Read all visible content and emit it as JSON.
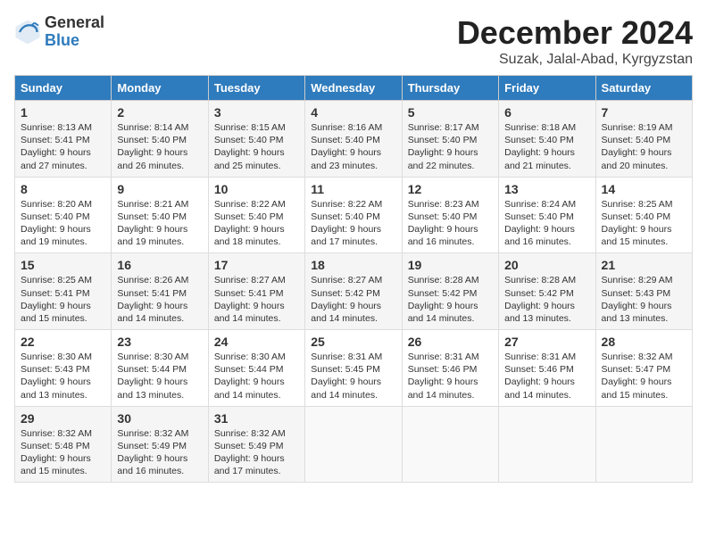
{
  "header": {
    "logo_general": "General",
    "logo_blue": "Blue",
    "month": "December 2024",
    "location": "Suzak, Jalal-Abad, Kyrgyzstan"
  },
  "days_of_week": [
    "Sunday",
    "Monday",
    "Tuesday",
    "Wednesday",
    "Thursday",
    "Friday",
    "Saturday"
  ],
  "weeks": [
    [
      {
        "day": "1",
        "info": "Sunrise: 8:13 AM\nSunset: 5:41 PM\nDaylight: 9 hours and 27 minutes."
      },
      {
        "day": "2",
        "info": "Sunrise: 8:14 AM\nSunset: 5:40 PM\nDaylight: 9 hours and 26 minutes."
      },
      {
        "day": "3",
        "info": "Sunrise: 8:15 AM\nSunset: 5:40 PM\nDaylight: 9 hours and 25 minutes."
      },
      {
        "day": "4",
        "info": "Sunrise: 8:16 AM\nSunset: 5:40 PM\nDaylight: 9 hours and 23 minutes."
      },
      {
        "day": "5",
        "info": "Sunrise: 8:17 AM\nSunset: 5:40 PM\nDaylight: 9 hours and 22 minutes."
      },
      {
        "day": "6",
        "info": "Sunrise: 8:18 AM\nSunset: 5:40 PM\nDaylight: 9 hours and 21 minutes."
      },
      {
        "day": "7",
        "info": "Sunrise: 8:19 AM\nSunset: 5:40 PM\nDaylight: 9 hours and 20 minutes."
      }
    ],
    [
      {
        "day": "8",
        "info": "Sunrise: 8:20 AM\nSunset: 5:40 PM\nDaylight: 9 hours and 19 minutes."
      },
      {
        "day": "9",
        "info": "Sunrise: 8:21 AM\nSunset: 5:40 PM\nDaylight: 9 hours and 19 minutes."
      },
      {
        "day": "10",
        "info": "Sunrise: 8:22 AM\nSunset: 5:40 PM\nDaylight: 9 hours and 18 minutes."
      },
      {
        "day": "11",
        "info": "Sunrise: 8:22 AM\nSunset: 5:40 PM\nDaylight: 9 hours and 17 minutes."
      },
      {
        "day": "12",
        "info": "Sunrise: 8:23 AM\nSunset: 5:40 PM\nDaylight: 9 hours and 16 minutes."
      },
      {
        "day": "13",
        "info": "Sunrise: 8:24 AM\nSunset: 5:40 PM\nDaylight: 9 hours and 16 minutes."
      },
      {
        "day": "14",
        "info": "Sunrise: 8:25 AM\nSunset: 5:40 PM\nDaylight: 9 hours and 15 minutes."
      }
    ],
    [
      {
        "day": "15",
        "info": "Sunrise: 8:25 AM\nSunset: 5:41 PM\nDaylight: 9 hours and 15 minutes."
      },
      {
        "day": "16",
        "info": "Sunrise: 8:26 AM\nSunset: 5:41 PM\nDaylight: 9 hours and 14 minutes."
      },
      {
        "day": "17",
        "info": "Sunrise: 8:27 AM\nSunset: 5:41 PM\nDaylight: 9 hours and 14 minutes."
      },
      {
        "day": "18",
        "info": "Sunrise: 8:27 AM\nSunset: 5:42 PM\nDaylight: 9 hours and 14 minutes."
      },
      {
        "day": "19",
        "info": "Sunrise: 8:28 AM\nSunset: 5:42 PM\nDaylight: 9 hours and 14 minutes."
      },
      {
        "day": "20",
        "info": "Sunrise: 8:28 AM\nSunset: 5:42 PM\nDaylight: 9 hours and 13 minutes."
      },
      {
        "day": "21",
        "info": "Sunrise: 8:29 AM\nSunset: 5:43 PM\nDaylight: 9 hours and 13 minutes."
      }
    ],
    [
      {
        "day": "22",
        "info": "Sunrise: 8:30 AM\nSunset: 5:43 PM\nDaylight: 9 hours and 13 minutes."
      },
      {
        "day": "23",
        "info": "Sunrise: 8:30 AM\nSunset: 5:44 PM\nDaylight: 9 hours and 13 minutes."
      },
      {
        "day": "24",
        "info": "Sunrise: 8:30 AM\nSunset: 5:44 PM\nDaylight: 9 hours and 14 minutes."
      },
      {
        "day": "25",
        "info": "Sunrise: 8:31 AM\nSunset: 5:45 PM\nDaylight: 9 hours and 14 minutes."
      },
      {
        "day": "26",
        "info": "Sunrise: 8:31 AM\nSunset: 5:46 PM\nDaylight: 9 hours and 14 minutes."
      },
      {
        "day": "27",
        "info": "Sunrise: 8:31 AM\nSunset: 5:46 PM\nDaylight: 9 hours and 14 minutes."
      },
      {
        "day": "28",
        "info": "Sunrise: 8:32 AM\nSunset: 5:47 PM\nDaylight: 9 hours and 15 minutes."
      }
    ],
    [
      {
        "day": "29",
        "info": "Sunrise: 8:32 AM\nSunset: 5:48 PM\nDaylight: 9 hours and 15 minutes."
      },
      {
        "day": "30",
        "info": "Sunrise: 8:32 AM\nSunset: 5:49 PM\nDaylight: 9 hours and 16 minutes."
      },
      {
        "day": "31",
        "info": "Sunrise: 8:32 AM\nSunset: 5:49 PM\nDaylight: 9 hours and 17 minutes."
      },
      {
        "day": "",
        "info": ""
      },
      {
        "day": "",
        "info": ""
      },
      {
        "day": "",
        "info": ""
      },
      {
        "day": "",
        "info": ""
      }
    ]
  ]
}
